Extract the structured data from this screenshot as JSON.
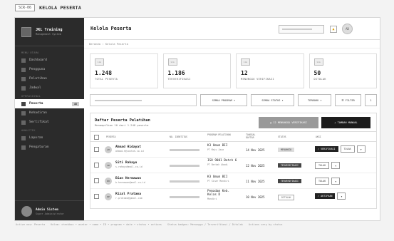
{
  "screen": {
    "tag": "SCR-06",
    "title": "KELOLA PESERTA"
  },
  "sidebar": {
    "brand_name": "JKL Training",
    "brand_sub": "Management System",
    "sections": [
      {
        "label": "MENU UTAMA",
        "items": [
          {
            "label": "Dashboard"
          },
          {
            "label": "Pengguna"
          },
          {
            "label": "Pelatihan"
          },
          {
            "label": "Jadwal"
          }
        ]
      },
      {
        "label": "OPERASIONAL",
        "items": [
          {
            "label": "Peserta",
            "badge": "48"
          },
          {
            "label": "Kehadiran"
          },
          {
            "label": "Sertifikat"
          }
        ]
      },
      {
        "label": "ANALITIK",
        "items": [
          {
            "label": "Laporan"
          },
          {
            "label": "Pengaturan"
          }
        ]
      }
    ],
    "user": {
      "name": "Admin Sistem",
      "role": "Super Administrator"
    }
  },
  "header": {
    "title": "Kelola Peserta",
    "bell": "▲",
    "avatar": "AD"
  },
  "breadcrumb": "Beranda › Kelola Peserta",
  "stats": [
    {
      "icon": "ico",
      "value": "1.248",
      "label": "TOTAL PESERTA"
    },
    {
      "icon": "ico",
      "value": "1.186",
      "label": "TERVERIFIKASI"
    },
    {
      "icon": "ico",
      "value": "12",
      "label": "MENUNGGU VERIFIKASI"
    },
    {
      "icon": "ico",
      "value": "50",
      "label": "DITOLAK"
    }
  ],
  "filters": {
    "program": "SEMUA PROGRAM ▾",
    "status": "SEMUA STATUS ▾",
    "period": "TERBARU ▾",
    "filter": "☰ FILTER",
    "page": "1"
  },
  "list": {
    "title": "Daftar Peserta Pelatihan",
    "subtitle": "Menampilkan 10 dari 1.248 peserta",
    "verify_btn": "▲ 12 MENUNGGU VERIFIKASI",
    "add_btn": "+ TAMBAH MANUAL",
    "columns": [
      "PESERTA",
      "NO. IDENTITAS",
      "PROGRAM PELATIHAN",
      "TANGGAL DAFTAR",
      "STATUS",
      "AKSI"
    ],
    "rows": [
      {
        "initials": "AH",
        "name": "Ahmad Hidayat",
        "email": "ahmad.h@contoh.co.id",
        "program": "K3 Umum BII",
        "program_sub": "PT Maju Jaya",
        "date": "14 Nov 2025",
        "status": "MENUNGGU",
        "status_style": "light",
        "actions": [
          "✓ VERIFIKASI",
          "TOLAK"
        ]
      },
      {
        "initials": "SR",
        "name": "Siti Rahayu",
        "email": "s.rahayu@mail.co.id",
        "program": "ISO 9001 Batch 6",
        "program_sub": "PT Berkah Abadi",
        "date": "12 Nov 2025",
        "status": "TERVERIFIKASI",
        "status_style": "dark",
        "actions": [
          "TOLAK"
        ]
      },
      {
        "initials": "BH",
        "name": "Bian Hermawan",
        "email": "b.hermawan@mail.co.id",
        "program": "K3 Umum BII",
        "program_sub": "PT Sinar Mandiri",
        "date": "11 Nov 2025",
        "status": "TERVERIFIKASI",
        "status_style": "dark",
        "actions": [
          "TOLAK"
        ]
      },
      {
        "initials": "RP",
        "name": "Rizal Pratama",
        "email": "r.pratama@gmail.com",
        "program": "Pemadam Keb. Kelas D",
        "program_sub": "Mandiri",
        "date": "10 Nov 2025",
        "status": "DITOLAK",
        "status_style": "outline",
        "actions": [
          "✓ AKTIFKAN"
        ]
      }
    ],
    "more": "▾"
  },
  "footer_notes": [
    "Active nav: Peserta",
    "Kolom: checkbox • avatar • nama • ID • program • date • status • actions",
    "Status badges: Menunggu / Terverifikasi / Ditolak",
    "Actions vary by status"
  ]
}
